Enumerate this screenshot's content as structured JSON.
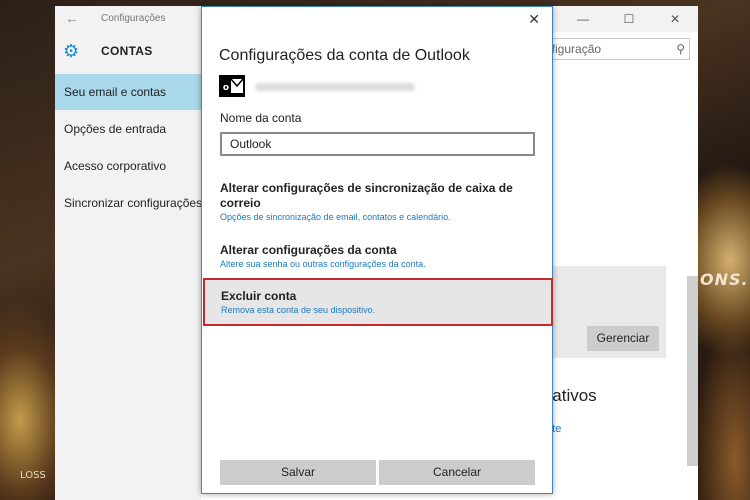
{
  "settings_window": {
    "title": "Configurações",
    "back_icon": "back-arrow-icon",
    "sidebar": {
      "header": "CONTAS",
      "items": [
        {
          "label": "Seu email e contas",
          "active": true
        },
        {
          "label": "Opções de entrada",
          "active": false
        },
        {
          "label": "Acesso corporativo",
          "active": false
        },
        {
          "label": "Sincronizar configurações",
          "active": false
        }
      ]
    },
    "search": {
      "text": "nfiguração"
    },
    "manage_label": "Gerenciar",
    "apps_title": "icativos",
    "apps_link": "ante"
  },
  "dialog": {
    "title": "Configurações da conta de Outlook",
    "account_name_label": "Nome da conta",
    "account_name_value": "Outlook",
    "options": [
      {
        "title": "Alterar configurações de sincronização de caixa de correio",
        "desc": "Opções de sincronização de email, contatos e calendário."
      },
      {
        "title": "Alterar configurações da conta",
        "desc": "Altere sua senha ou outras configurações da conta."
      },
      {
        "title": "Excluir conta",
        "desc": "Remova esta conta de seu dispositivo.",
        "highlighted": true
      }
    ],
    "save_label": "Salvar",
    "cancel_label": "Cancelar"
  },
  "wallpaper": {
    "text_right": "ONS.",
    "text_left": "LOSS"
  },
  "colors": {
    "accent": "#1a7ac4",
    "sidebar_active": "#a9d8ea",
    "highlight_border": "#c42b2b"
  }
}
